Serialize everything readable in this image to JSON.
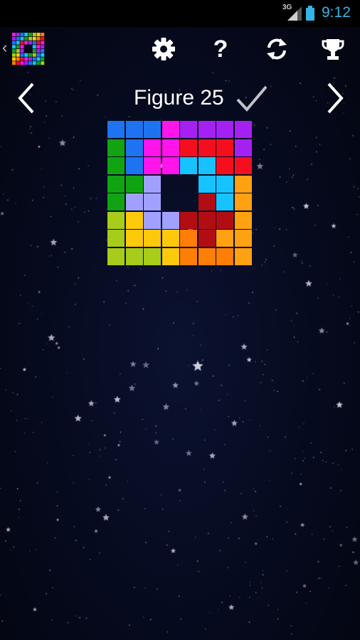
{
  "status_bar": {
    "network": "3G",
    "time": "9:12"
  },
  "toolbar": {
    "icons": [
      "app-logo-icon",
      "settings-gear-icon",
      "help-question-icon",
      "refresh-icon",
      "trophy-icon"
    ],
    "help_glyph": "?"
  },
  "level": {
    "title": "Figure 25",
    "solved": true
  },
  "colors": {
    "accent": "#33b5e5",
    "B": "#1e73f0",
    "M": "#ff14ea",
    "V": "#a520f2",
    "R": "#f50f1e",
    "C": "#16c2ff",
    "G": "#11a412",
    "L": "#a1a0ff",
    "D": "#b30d14",
    "O": "#ff7e06",
    "A": "#ffa110",
    "Y": "#ffc90b",
    "K": "#a7cc1a"
  },
  "puzzle": {
    "rows": [
      "BBBMVVVV",
      "GBMMRRRV",
      "GBMMCCRR",
      "GGL..CCA",
      "GLL..DCA",
      "KYLLDDDA",
      "KYYYODAA",
      "KKKYOOOA"
    ]
  }
}
